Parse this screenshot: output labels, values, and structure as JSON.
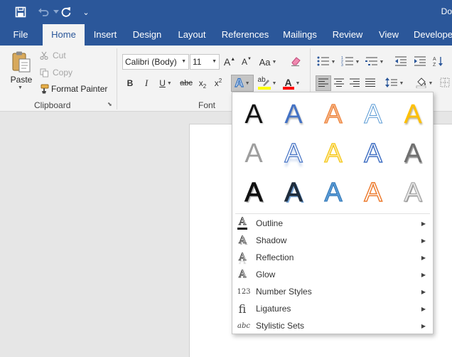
{
  "app": {
    "doc_title": "Do"
  },
  "quick_access": {
    "customize_glyph": "⌄"
  },
  "tabs": [
    {
      "label": "File"
    },
    {
      "label": "Home"
    },
    {
      "label": "Insert"
    },
    {
      "label": "Design"
    },
    {
      "label": "Layout"
    },
    {
      "label": "References"
    },
    {
      "label": "Mailings"
    },
    {
      "label": "Review"
    },
    {
      "label": "View"
    },
    {
      "label": "Develope"
    }
  ],
  "clipboard": {
    "paste_label": "Paste",
    "cut_label": "Cut",
    "copy_label": "Copy",
    "format_painter_label": "Format Painter",
    "group_label": "Clipboard"
  },
  "font": {
    "font_name": "Calibri (Body)",
    "font_size": "11",
    "grow_glyph": "A",
    "shrink_glyph": "A",
    "change_case_glyph": "Aa",
    "bold": "B",
    "italic": "I",
    "underline": "U",
    "strikethrough": "abc",
    "subscript": "x",
    "subscript_mark": "2",
    "superscript": "x",
    "superscript_mark": "2",
    "text_effects_glyph": "A",
    "highlight_glyph": "ab",
    "font_color_glyph": "A",
    "group_label": "Font"
  },
  "colors": {
    "title_bar": "#2b579a",
    "ribbon": "#f3f3f3",
    "highlight_yellow": "#ffff00",
    "font_red": "#ff0000"
  },
  "text_effects_menu": {
    "gallery_glyph": "A",
    "items": [
      {
        "label": "Outline",
        "icon": "outline-a-icon",
        "glyph": "A"
      },
      {
        "label": "Shadow",
        "icon": "shadow-a-icon",
        "glyph": "A"
      },
      {
        "label": "Reflection",
        "icon": "reflection-a-icon",
        "glyph": "A"
      },
      {
        "label": "Glow",
        "icon": "glow-a-icon",
        "glyph": "A"
      },
      {
        "label": "Number Styles",
        "icon": "number-styles-icon",
        "glyph": "123"
      },
      {
        "label": "Ligatures",
        "icon": "ligatures-icon",
        "glyph": "fi"
      },
      {
        "label": "Stylistic Sets",
        "icon": "stylistic-sets-icon",
        "glyph": "abc"
      }
    ]
  }
}
